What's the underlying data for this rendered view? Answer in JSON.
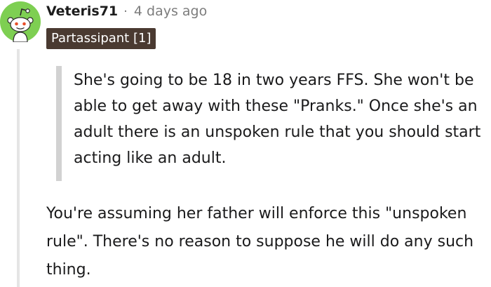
{
  "comment": {
    "author": "Veteris71",
    "separator": "·",
    "age": "4 days ago",
    "flair": "Partassipant [1]",
    "quote": "She's going to be 18 in two years FFS. She won't be able to get away with these \"Pranks.\" Once she's an adult there is an unspoken rule that you should start acting like an adult.",
    "body": "You're assuming her father will enforce this \"unspoken rule\". There's no reason to suppose he will do any such thing."
  },
  "colors": {
    "avatar_green": "#7ecf52",
    "flair_bg": "#4a3a31",
    "quote_bar": "#d2d2d2",
    "thread_line": "#e5e5e5",
    "meta_gray": "#7c7c7c"
  },
  "icons": {
    "avatar": "snoo-avatar-icon"
  }
}
